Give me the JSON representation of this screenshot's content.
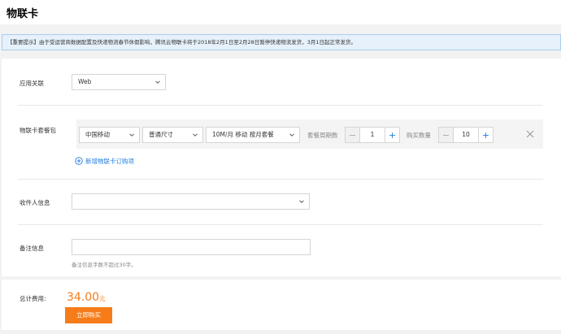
{
  "page": {
    "title": "物联卡"
  },
  "notice": {
    "text": "【重要提示】由于受运营商数据配置及快递物流春节休假影响，腾讯云物联卡将于2018年2月1日至2月28日暂停快递物流发货，3月1日起正常发货。"
  },
  "form": {
    "app_link": {
      "label": "应用关联",
      "value": "Web"
    },
    "package": {
      "label": "物联卡套餐包",
      "carrier": "中国移动",
      "size": "普通尺寸",
      "plan": "10M/月 移动 按月套餐",
      "period_label": "套餐周期数",
      "period_value": "1",
      "qty_label": "购买数量",
      "qty_value": "10",
      "add_link": "新增物联卡订购项"
    },
    "recipient": {
      "label": "收件人信息",
      "value": ""
    },
    "remark": {
      "label": "备注信息",
      "value": "",
      "hint": "备注信息字数不超过30字。"
    }
  },
  "footer": {
    "total_label": "总计费用:",
    "total_value": "34.00",
    "total_unit": "元",
    "buy_label": "立即购买"
  },
  "colors": {
    "accent": "#1f7ee0",
    "price": "#f57c19",
    "notice_bg": "#e6f1fb"
  },
  "icons": {
    "chevron": "chevron-down-icon",
    "plus": "plus-icon",
    "minus": "minus-icon",
    "close": "close-icon",
    "add": "plus-circle-icon"
  }
}
